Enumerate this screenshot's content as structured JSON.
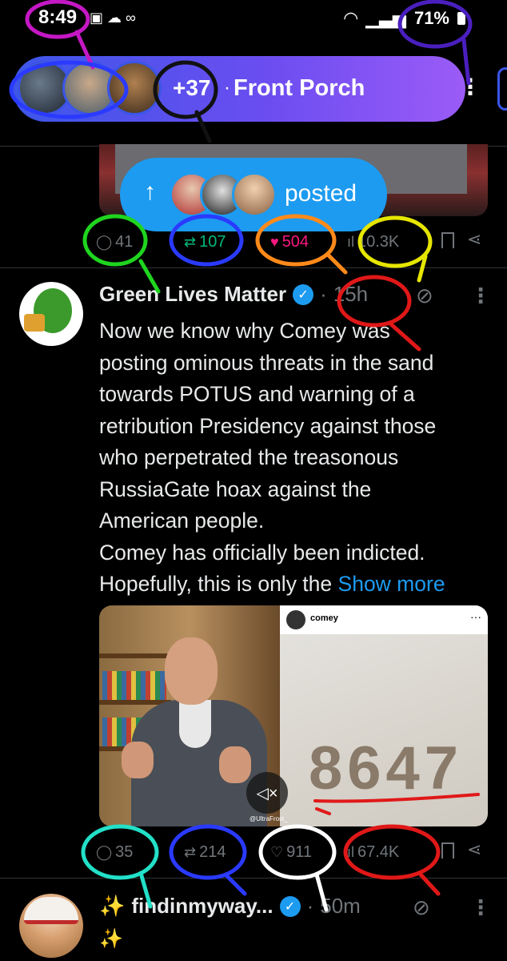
{
  "status_bar": {
    "time": "8:49",
    "battery": "71%"
  },
  "community_bar": {
    "member_count": "+37",
    "separator": "·",
    "name": "Front Porch",
    "more_icon": "more-vertical-icon",
    "gradient": [
      "#3d57e8",
      "#9b5bf7"
    ]
  },
  "posted_pill": {
    "arrow_icon": "arrow-up-icon",
    "label": "posted",
    "color": "#1d9bf0"
  },
  "previous_post": {
    "replies": "41",
    "reposts": "107",
    "likes": "504",
    "views": "10.3K",
    "reposted": true,
    "liked": true
  },
  "post": {
    "author": "Green Lives Matter",
    "verified": true,
    "time": "15h",
    "lines": [
      "Now we know why Comey was",
      "posting ominous threats in the sand",
      "towards POTUS and warning of a",
      "retribution Presidency against those",
      "who perpetrated the treasonous",
      "RussiaGate hoax against the",
      "American people.",
      "Comey has officially been indicted."
    ],
    "last_line": "Hopefully, this is only the",
    "show_more": "Show more",
    "media": {
      "embed_username": "comey",
      "sand_text": "8647",
      "watermark": "@UltraFrost_"
    },
    "replies": "35",
    "reposts": "214",
    "likes": "911",
    "views": "67.4K"
  },
  "next_post": {
    "author": "findinmyway...",
    "time": "50m",
    "separator": "·",
    "leading_emoji": "✨",
    "body_emoji": "✨"
  },
  "colors": {
    "background": "#000000",
    "text": "#e7e9ea",
    "muted": "#71767b",
    "accent_blue": "#1d9bf0",
    "repost_green": "#00ba7c",
    "like_pink": "#f91880"
  }
}
